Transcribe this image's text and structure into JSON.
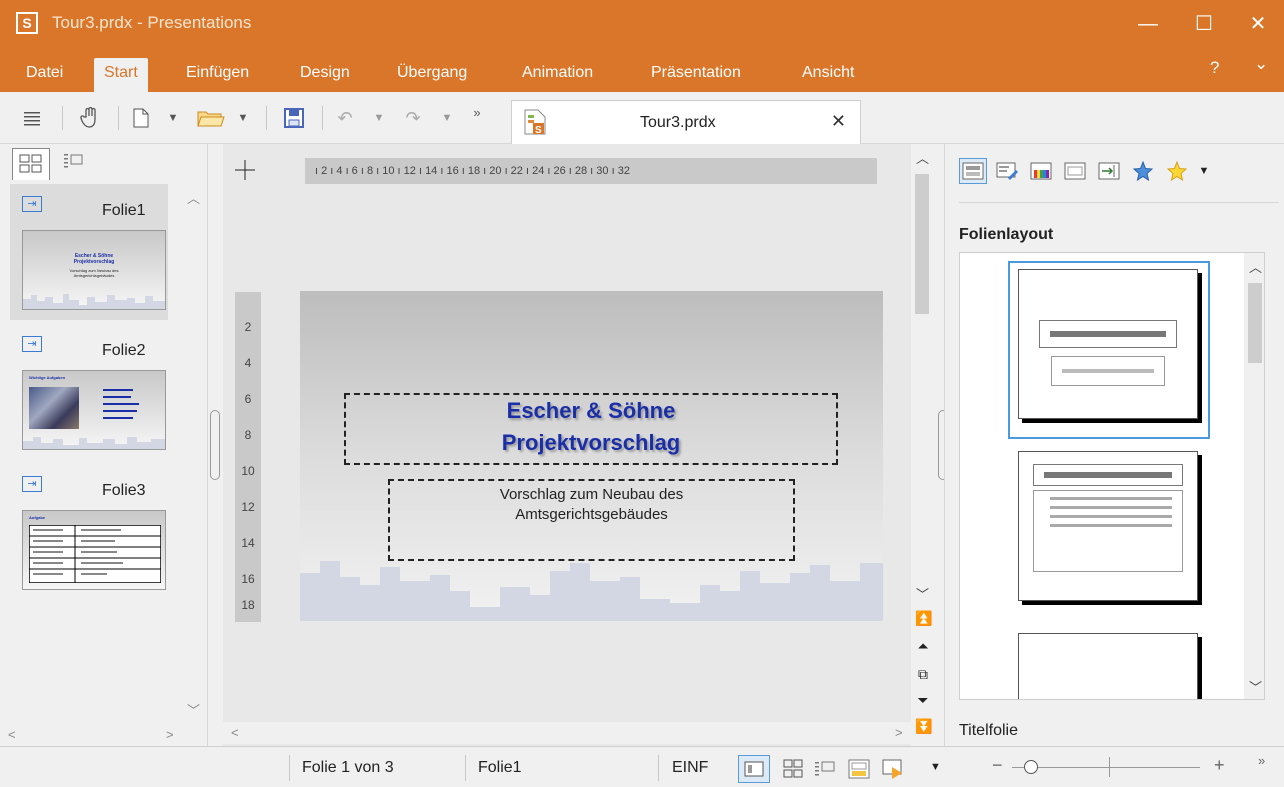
{
  "window": {
    "logo_letter": "S",
    "title": "Tour3.prdx - Presentations",
    "minimize": "—",
    "maximize": "☐",
    "close": "✕"
  },
  "ribbon": {
    "tabs": [
      "Datei",
      "Start",
      "Einfügen",
      "Design",
      "Übergang",
      "Animation",
      "Präsentation",
      "Ansicht"
    ],
    "active_tab": "Start",
    "help": "?",
    "collapse": "⌄"
  },
  "document_tab": {
    "name": "Tour3.prdx",
    "close": "✕"
  },
  "slides_panel": {
    "slides": [
      {
        "label": "Folie1",
        "thumb_title": "Escher & Söhne Projektvorschlag",
        "thumb_sub": "Vorschlag zum Neubau des Amtsgerichtsgebäudes"
      },
      {
        "label": "Folie2",
        "thumb_title": "Wichtige Aufgaben"
      },
      {
        "label": "Folie3",
        "thumb_title": "Aufgabe"
      }
    ],
    "selected_index": 0
  },
  "editor": {
    "hruler_text": "ı 2 ı 4 ı 6 ı 8 ı 10 ı 12 ı 14 ı 16 ı 18 ı 20 ı 22 ı 24 ı 26 ı 28 ı 30 ı 32",
    "vruler_marks": [
      "2",
      "4",
      "6",
      "8",
      "10",
      "12",
      "14",
      "16",
      "18"
    ],
    "slide": {
      "title_line1": "Escher & Söhne",
      "title_line2": "Projektvorschlag",
      "subtitle_line1": "Vorschlag zum Neubau des",
      "subtitle_line2": "Amtsgerichtsgebäudes"
    }
  },
  "layout_panel": {
    "heading": "Folienlayout",
    "selected_caption": "Titelfolie"
  },
  "statusbar": {
    "slide_position": "Folie 1 von 3",
    "slide_name": "Folie1",
    "mode": "EINF",
    "zoom_minus": "−",
    "zoom_plus": "+",
    "more": "»"
  },
  "colors": {
    "accent": "#d9762a",
    "title_text": "#1a2ea8",
    "selection_blue": "#4a9ae0"
  }
}
